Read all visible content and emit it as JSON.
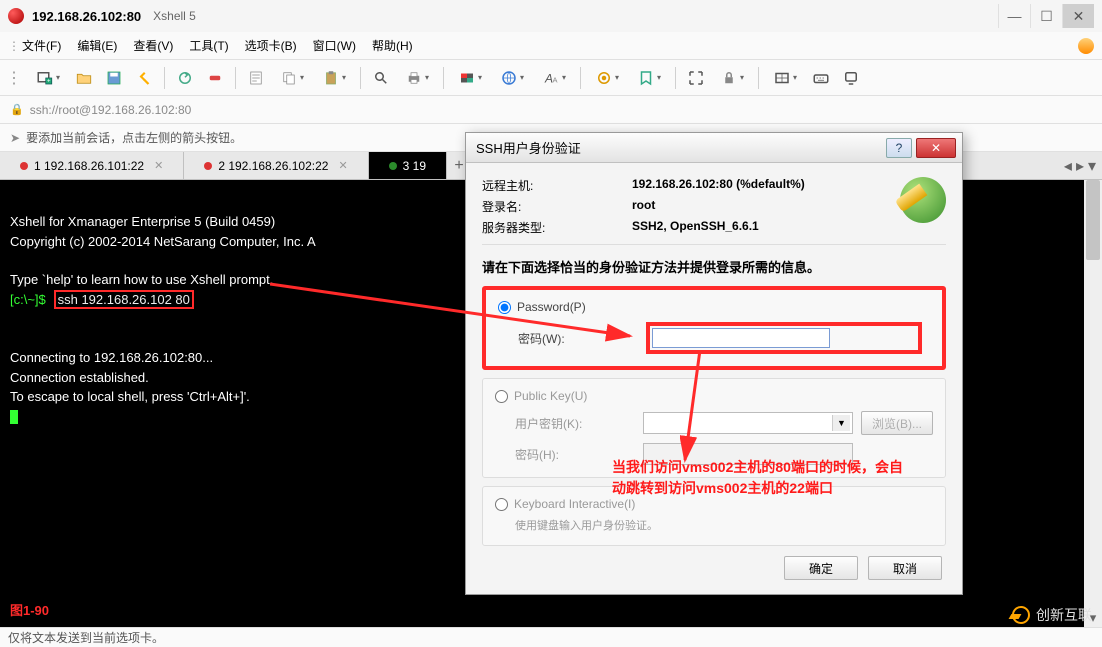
{
  "window": {
    "title": "192.168.26.102:80",
    "subtitle": "Xshell 5"
  },
  "menu": {
    "file": "文件(F)",
    "edit": "编辑(E)",
    "view": "查看(V)",
    "tools": "工具(T)",
    "tabs": "选项卡(B)",
    "window": "窗口(W)",
    "help": "帮助(H)"
  },
  "address": "ssh://root@192.168.26.102:80",
  "hint": "要添加当前会话，点击左侧的箭头按钮。",
  "tabs": {
    "t1": {
      "label": "1 192.168.26.101:22"
    },
    "t2": {
      "label": "2 192.168.26.102:22"
    },
    "t3": {
      "label": "3 19"
    }
  },
  "terminal": {
    "l1": "Xshell for Xmanager Enterprise 5 (Build 0459)",
    "l2": "Copyright (c) 2002-2014 NetSarang Computer, Inc. A",
    "l3": "Type `help' to learn how to use Xshell prompt.",
    "prompt": "[c:\\~]$",
    "cmd": "ssh 192.168.26.102 80",
    "l5": "Connecting to 192.168.26.102:80...",
    "l6": "Connection established.",
    "l7": "To escape to local shell, press 'Ctrl+Alt+]'.",
    "figure": "图1-90"
  },
  "dialog": {
    "title": "SSH用户身份验证",
    "remote_k": "远程主机:",
    "remote_v": "192.168.26.102:80 (%default%)",
    "login_k": "登录名:",
    "login_v": "root",
    "server_k": "服务器类型:",
    "server_v": "SSH2, OpenSSH_6.6.1",
    "prompt": "请在下面选择恰当的身份验证方法并提供登录所需的信息。",
    "pw_radio": "Password(P)",
    "pw_label": "密码(W):",
    "pk_radio": "Public Key(U)",
    "pk_user": "用户密钥(K):",
    "pk_pass": "密码(H):",
    "browse": "浏览(B)...",
    "ki_radio": "Keyboard Interactive(I)",
    "ki_hint": "使用键盘输入用户身份验证。",
    "ok": "确定",
    "cancel": "取消"
  },
  "annotation": {
    "line1": "当我们访问vms002主机的80端口的时候，会自",
    "line2": "动跳转到访问vms002主机的22端口"
  },
  "status": "仅将文本发送到当前选项卡。",
  "watermark": "创新互联"
}
